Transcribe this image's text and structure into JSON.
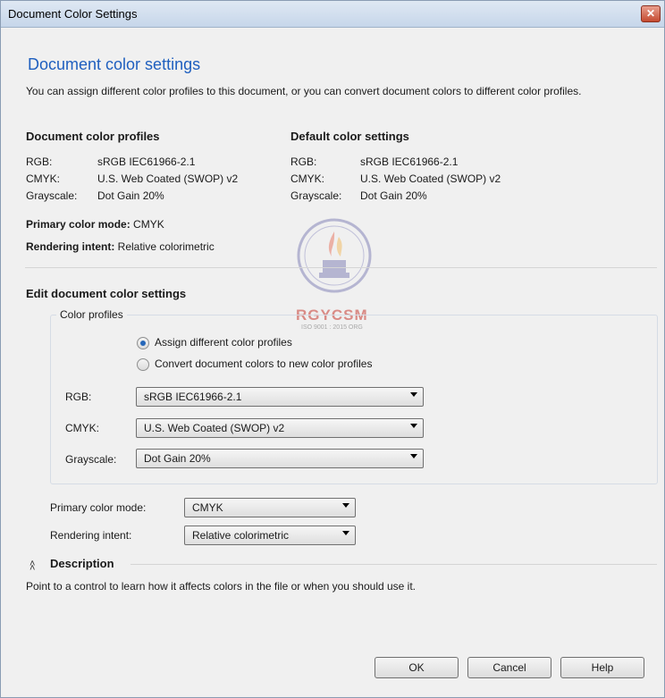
{
  "window": {
    "title": "Document Color Settings",
    "close_glyph": "✕"
  },
  "header": {
    "title": "Document color settings",
    "description": "You can assign different color profiles to this document, or you can convert document colors to different color profiles."
  },
  "document_profiles": {
    "heading": "Document color profiles",
    "rows": [
      {
        "label": "RGB:",
        "value": "sRGB IEC61966-2.1"
      },
      {
        "label": "CMYK:",
        "value": "U.S. Web Coated (SWOP) v2"
      },
      {
        "label": "Grayscale:",
        "value": "Dot Gain 20%"
      }
    ]
  },
  "default_settings": {
    "heading": "Default color settings",
    "rows": [
      {
        "label": "RGB:",
        "value": "sRGB IEC61966-2.1"
      },
      {
        "label": "CMYK:",
        "value": "U.S. Web Coated (SWOP) v2"
      },
      {
        "label": "Grayscale:",
        "value": "Dot Gain 20%"
      }
    ]
  },
  "primary_mode": {
    "label": "Primary color mode:",
    "value": "CMYK"
  },
  "rendering": {
    "label": "Rendering intent:",
    "value": "Relative colorimetric"
  },
  "edit": {
    "heading": "Edit document color settings",
    "group_label": "Color profiles",
    "radio_assign": "Assign different color profiles",
    "radio_convert": "Convert document colors to new color profiles",
    "selected": "assign",
    "rgb": {
      "label": "RGB:",
      "value": "sRGB IEC61966-2.1"
    },
    "cmyk": {
      "label": "CMYK:",
      "value": "U.S. Web Coated (SWOP) v2"
    },
    "grayscale": {
      "label": "Grayscale:",
      "value": "Dot Gain 20%"
    },
    "primary_mode": {
      "label": "Primary color mode:",
      "value": "CMYK"
    },
    "rendering": {
      "label": "Rendering intent:",
      "value": "Relative colorimetric"
    }
  },
  "description_section": {
    "heading": "Description",
    "text": "Point to a control to learn how it affects colors in the file or when you should use it."
  },
  "watermark": {
    "text": "RGYCSM",
    "subtext": "ISO 9001 : 2015 ORG"
  },
  "buttons": {
    "ok": "OK",
    "cancel": "Cancel",
    "help": "Help"
  },
  "colors": {
    "title_blue": "#1f5fbf",
    "radio_selected": "#2667b9"
  }
}
